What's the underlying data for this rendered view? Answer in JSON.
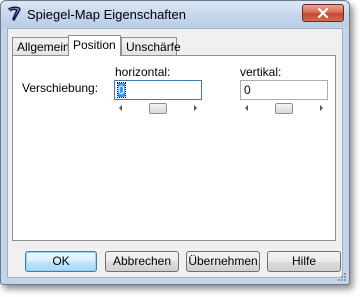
{
  "window": {
    "title": "Spiegel-Map Eigenschaften",
    "app_icon": "script-v-icon",
    "close_icon": "close-icon"
  },
  "tabs": [
    {
      "label": "Allgemein",
      "active": false
    },
    {
      "label": "Position",
      "active": true
    },
    {
      "label": "Unschärfe",
      "active": false
    }
  ],
  "position_tab": {
    "offset_label": "Verschiebung:",
    "horizontal": {
      "label": "horizontal:",
      "value": "0",
      "slider_fraction": 0.5
    },
    "vertical": {
      "label": "vertikal:",
      "value": "0",
      "slider_fraction": 0.5
    }
  },
  "buttons": {
    "ok": "OK",
    "cancel": "Abbrechen",
    "apply": "Übernehmen",
    "help": "Hilfe"
  },
  "colors": {
    "frame": "#c4d5e9",
    "close_button": "#c14a30",
    "default_button_border": "#3c7fb1",
    "selection": "#3399ff"
  }
}
